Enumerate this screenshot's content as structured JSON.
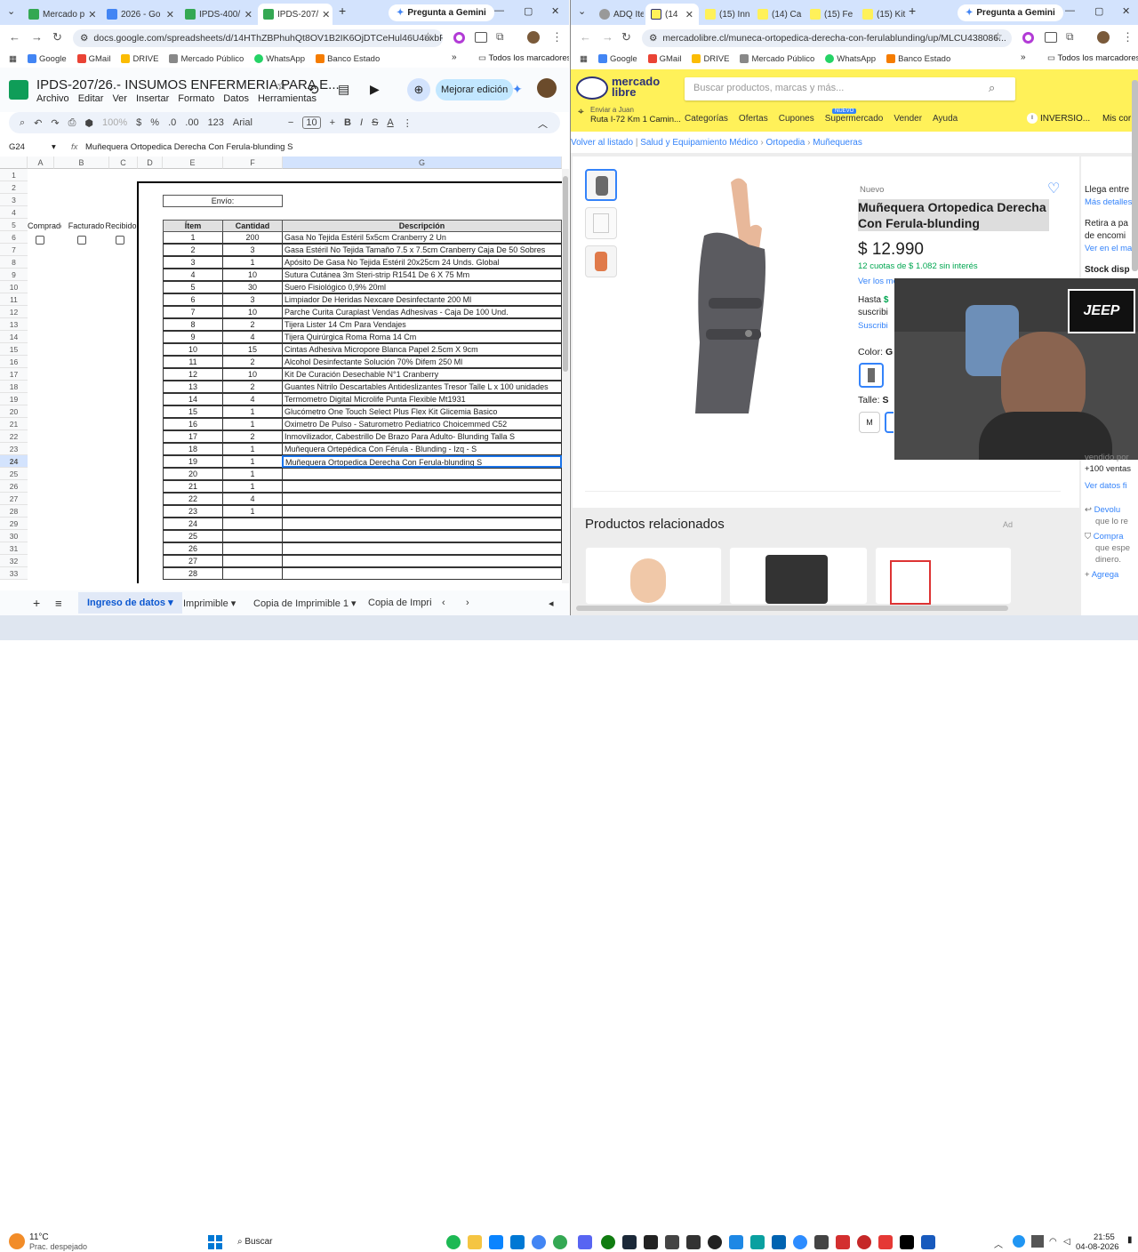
{
  "left": {
    "tabs": [
      "Mercado p",
      "2026 - Go",
      "IPDS-400/",
      "IPDS-207/"
    ],
    "gemini": "Pregunta a Gemini",
    "url": "docs.google.com/spreadsheets/d/14HThZBPhuhQt8OV1B2IK6OjDTCeHul46U4oxbPgG...",
    "bookmarks": [
      "Google",
      "GMail",
      "DRIVE",
      "Mercado Público",
      "WhatsApp",
      "Banco Estado"
    ],
    "bookmarks_right": "Todos los marcadores",
    "doc_title": "IPDS-207/26.- INSUMOS ENFERMERIA PARA E...",
    "menu": [
      "Archivo",
      "Editar",
      "Ver",
      "Insertar",
      "Formato",
      "Datos",
      "Herramientas"
    ],
    "improve": "Mejorar edición",
    "toolbar": {
      "zoom": "100%",
      "currency": "$",
      "percent": "%",
      "dec": ".0",
      "dec2": ".00",
      "fmt": "123",
      "font": "Arial",
      "size": "10"
    },
    "cellref": "G24",
    "formula": "Muñequera Ortopedica Derecha Con Ferula-blunding S",
    "cols": [
      "A",
      "B",
      "C",
      "D",
      "E",
      "F",
      "G"
    ],
    "envio": "Envío:",
    "headers": {
      "a": "Comprado",
      "b": "Facturado",
      "c": "Recibido",
      "item": "Ítem",
      "qty": "Cantidad",
      "desc": "Descripción"
    },
    "rows": [
      {
        "n": "6",
        "item": "1",
        "qty": "200",
        "desc": "Gasa No Tejida Estéril 5x5cm Cranberry 2 Un"
      },
      {
        "n": "7",
        "item": "2",
        "qty": "3",
        "desc": "Gasa Estéril No Tejida Tamaño 7.5 x 7.5cm Cranberry Caja De 50 Sobres"
      },
      {
        "n": "8",
        "item": "3",
        "qty": "1",
        "desc": "Apósito De Gasa No Tejida Estéril 20x25cm 24 Unds. Global"
      },
      {
        "n": "9",
        "item": "4",
        "qty": "10",
        "desc": "Sutura Cutánea 3m Steri-strip R1541 De 6 X 75 Mm"
      },
      {
        "n": "10",
        "item": "5",
        "qty": "30",
        "desc": "Suero Fisiológico 0,9% 20ml"
      },
      {
        "n": "11",
        "item": "6",
        "qty": "3",
        "desc": "Limpiador De Heridas Nexcare Desinfectante 200 Ml"
      },
      {
        "n": "12",
        "item": "7",
        "qty": "10",
        "desc": "Parche Curita Curaplast Vendas Adhesivas - Caja De 100 Und."
      },
      {
        "n": "13",
        "item": "8",
        "qty": "2",
        "desc": "Tijera Lister 14 Cm Para Vendajes"
      },
      {
        "n": "14",
        "item": "9",
        "qty": "4",
        "desc": "Tijera Quirúrgica Roma Roma 14 Cm"
      },
      {
        "n": "15",
        "item": "10",
        "qty": "15",
        "desc": "Cintas Adhesiva Micropore Blanca Papel 2.5cm X 9cm"
      },
      {
        "n": "16",
        "item": "11",
        "qty": "2",
        "desc": "Alcohol Desinfectante Solución 70% Difem 250 Ml"
      },
      {
        "n": "17",
        "item": "12",
        "qty": "10",
        "desc": "Kit De Curación Desechable N°1 Cranberry"
      },
      {
        "n": "18",
        "item": "13",
        "qty": "2",
        "desc": "Guantes Nitrilo Descartables Antideslizantes Tresor Talle L x 100 unidades"
      },
      {
        "n": "19",
        "item": "14",
        "qty": "4",
        "desc": "Termometro Digital Microlife Punta Flexible Mt1931"
      },
      {
        "n": "20",
        "item": "15",
        "qty": "1",
        "desc": "Glucómetro One Touch Select Plus Flex Kit Glicemia Basico"
      },
      {
        "n": "21",
        "item": "16",
        "qty": "1",
        "desc": "Oximetro De Pulso - Saturometro Pediatrico Choicemmed C52"
      },
      {
        "n": "22",
        "item": "17",
        "qty": "2",
        "desc": "Inmovilizador, Cabestrillo De Brazo Para Adulto- Blunding Talla S"
      },
      {
        "n": "23",
        "item": "18",
        "qty": "1",
        "desc": "Muñequera Ortepédica Con Férula - Blunding - Izq - S"
      },
      {
        "n": "24",
        "item": "19",
        "qty": "1",
        "desc": "Muñequera Ortopedica Derecha Con Ferula-blunding S"
      },
      {
        "n": "25",
        "item": "20",
        "qty": "1",
        "desc": ""
      },
      {
        "n": "26",
        "item": "21",
        "qty": "1",
        "desc": ""
      },
      {
        "n": "27",
        "item": "22",
        "qty": "4",
        "desc": ""
      },
      {
        "n": "28",
        "item": "23",
        "qty": "1",
        "desc": ""
      },
      {
        "n": "29",
        "item": "24",
        "qty": "",
        "desc": ""
      },
      {
        "n": "30",
        "item": "25",
        "qty": "",
        "desc": ""
      },
      {
        "n": "31",
        "item": "26",
        "qty": "",
        "desc": ""
      },
      {
        "n": "32",
        "item": "27",
        "qty": "",
        "desc": ""
      },
      {
        "n": "33",
        "item": "28",
        "qty": "",
        "desc": ""
      }
    ],
    "emptyrows": [
      "1",
      "2",
      "3",
      "4",
      "5"
    ],
    "sheets": [
      "Ingreso de datos",
      "Imprimible",
      "Copia de Imprimible 1",
      "Copia de Imprim"
    ]
  },
  "right": {
    "tabs": [
      "ADQ Ite",
      "(14",
      "(15) Inn",
      "(14) Ca",
      "(15) Fe",
      "(15) Kit"
    ],
    "gemini": "Pregunta a Gemini",
    "url": "mercadolibre.cl/muneca-ortopedica-derecha-con-ferulablunding/up/MLCU438086...",
    "bookmarks": [
      "Google",
      "GMail",
      "DRIVE",
      "Mercado Público",
      "WhatsApp",
      "Banco Estado"
    ],
    "bookmarks_right": "Todos los marcadores",
    "logo1": "mercado",
    "logo2": "libre",
    "search_placeholder": "Buscar productos, marcas y más...",
    "send_to": "Enviar a Juan",
    "send_addr": "Ruta I-72 Km 1 Camin...",
    "menu": [
      "Categorías",
      "Ofertas",
      "Cupones",
      "Supermercado",
      "Vender",
      "Ayuda"
    ],
    "nuevo_badge": "NUEVO",
    "inversion": "INVERSIO...",
    "mis": "Mis cor",
    "back": "Volver al listado",
    "crumbs": [
      "Salud y Equipamiento Médico",
      "Ortopedia",
      "Muñequeras"
    ],
    "condition": "Nuevo",
    "title": "Muñequera Ortopedica Derecha Con Ferula-blunding",
    "price_sym": "$",
    "price": "12.990",
    "installments": "12 cuotas de $ 1.082 sin interés",
    "ver_medios": "Ver los me",
    "hasta": "Hasta",
    "hasta_val": "$",
    "suscrib": "suscribi",
    "suscrib2": "Suscribi",
    "color_label": "Color:",
    "color_val": "G",
    "talle_label": "Talle:",
    "talle_val": "S",
    "size_opt": "M",
    "side": [
      "Llega entre",
      "Más detalles",
      "Retira a pa",
      "de encomi",
      "Ver en el ma",
      "Stock disp",
      "vendido por",
      "+100 ventas",
      "Ver datos fi",
      "Devolu",
      "que lo re",
      "Compra",
      "que espe",
      "dinero.",
      "Agrega"
    ],
    "related": "Productos relacionados",
    "ad": "Ad",
    "webcam_badge": "JEEP"
  },
  "taskbar": {
    "temp": "11°C",
    "weather": "Prac. despejado",
    "search": "Buscar",
    "time": "21:55",
    "date": "04-08-2026"
  }
}
